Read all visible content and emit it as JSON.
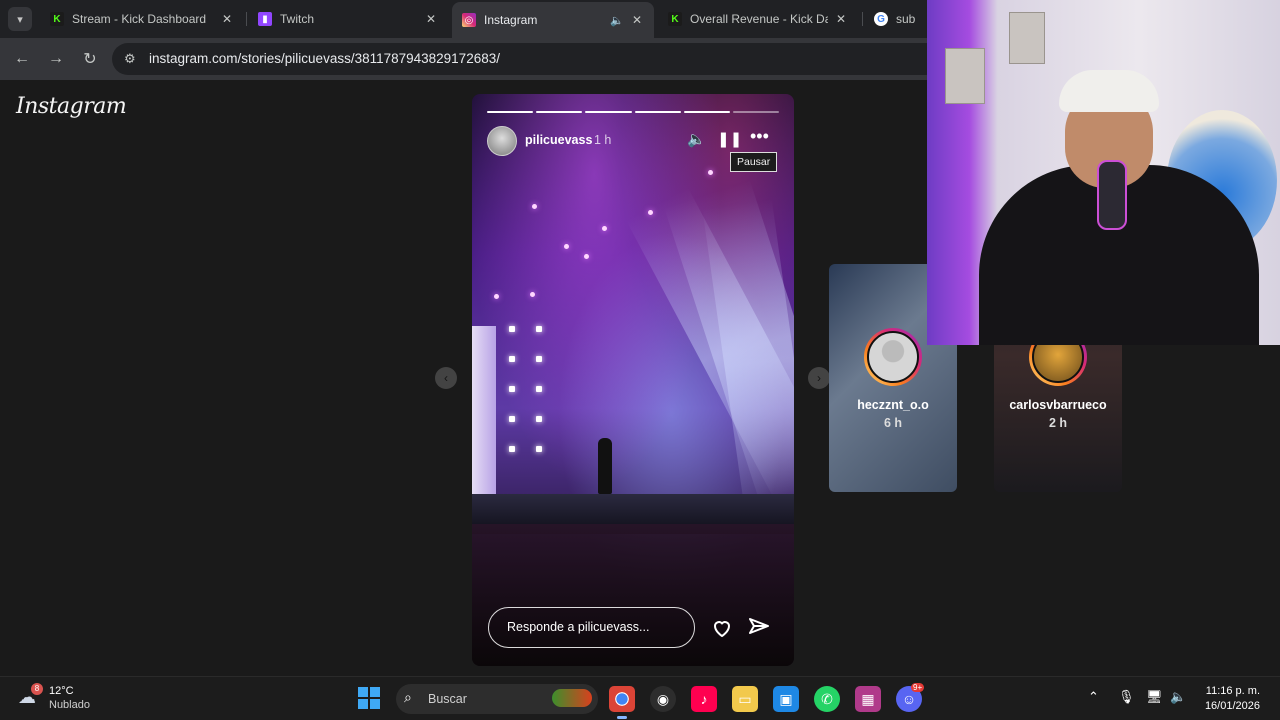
{
  "browser": {
    "tabs": [
      {
        "title": "Stream - Kick Dashboard",
        "favicon": "kick-icon",
        "color": "#53fc18"
      },
      {
        "title": "Twitch",
        "favicon": "twitch-icon",
        "color": "#9146ff"
      },
      {
        "title": "Instagram",
        "favicon": "instagram-icon",
        "color": "#e1306c",
        "active": true
      },
      {
        "title": "Overall Revenue - Kick Dash",
        "favicon": "kick-icon",
        "color": "#53fc18"
      },
      {
        "title": "sub ce",
        "favicon": "google-icon",
        "color": "#4285f4"
      }
    ],
    "url": "instagram.com/stories/pilicuevass/3811787943829172683/"
  },
  "instagram": {
    "logo": "Instagram",
    "story": {
      "username": "pilicuevass",
      "time": "1 h",
      "tooltip": "Pausar",
      "reply_placeholder": "Responde a pilicuevass...",
      "progress_segments": 6,
      "progress_done": 5
    },
    "previews": [
      {
        "username": "heczznt_o.o",
        "time": "6 h"
      },
      {
        "username": "carlosvbarrueco",
        "time": "2 h"
      }
    ]
  },
  "taskbar": {
    "weather": {
      "temp": "12°C",
      "desc": "Nublado",
      "badge": "8"
    },
    "search_label": "Buscar",
    "clock_time": "11:16 p. m.",
    "clock_date": "16/01/2026",
    "notification_badge": "9+"
  }
}
